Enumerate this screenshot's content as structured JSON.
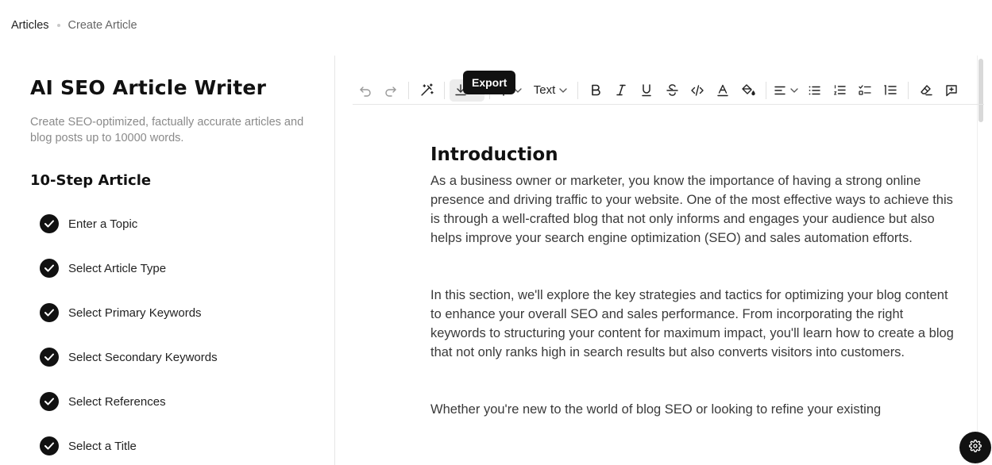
{
  "breadcrumb": {
    "parent": "Articles",
    "current": "Create Article"
  },
  "panel": {
    "title": "AI SEO Article Writer",
    "description": "Create SEO-optimized, factually accurate articles and blog posts up to 10000 words.",
    "steps_title": "10-Step Article",
    "steps": [
      {
        "label": "Enter a Topic",
        "done": true
      },
      {
        "label": "Select Article Type",
        "done": true
      },
      {
        "label": "Select Primary Keywords",
        "done": true
      },
      {
        "label": "Select Secondary Keywords",
        "done": true
      },
      {
        "label": "Select References",
        "done": true
      },
      {
        "label": "Select a Title",
        "done": true
      }
    ]
  },
  "toolbar": {
    "tooltip": "Export",
    "text_style": "Text",
    "icons": [
      "undo-icon",
      "redo-icon",
      "magic-wand-icon",
      "export-download-icon",
      "insert-plus-icon",
      "bold-icon",
      "italic-icon",
      "underline-icon",
      "strikethrough-icon",
      "code-icon",
      "text-color-icon",
      "highlight-icon",
      "align-icon",
      "bullet-list-icon",
      "ordered-list-icon",
      "task-list-icon",
      "numbered-steps-icon",
      "clear-format-icon",
      "comment-icon"
    ]
  },
  "document": {
    "heading": "Introduction",
    "paragraphs": [
      "As a business owner or marketer, you know the importance of having a strong online presence and driving traffic to your website. One of the most effective ways to achieve this is through a well-crafted blog that not only informs and engages your audience but also helps improve your search engine optimization (SEO) and sales automation efforts.",
      "In this section, we'll explore the key strategies and tactics for optimizing your blog content to enhance your overall SEO and sales performance. From incorporating the right keywords to structuring your content for maximum impact, you'll learn how to create a blog that not only ranks high in search results but also converts visitors into customers.",
      "Whether you're new to the world of blog SEO or looking to refine your existing"
    ]
  },
  "colors": {
    "accent": "#111111",
    "muted": "#8a8a8a",
    "divider": "#e6e6e6"
  }
}
